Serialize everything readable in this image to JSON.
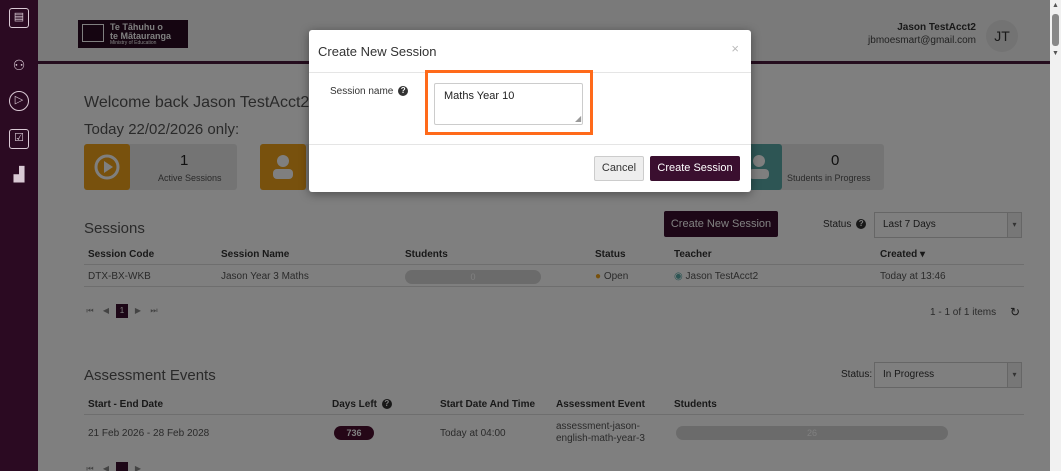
{
  "sidebar": {
    "icons": [
      "book-icon",
      "people-icon",
      "play-circle-icon",
      "checklist-icon",
      "bar-chart-icon"
    ]
  },
  "header": {
    "logo_line1": "Te Tāhuhu o",
    "logo_line2": "te Mātauranga",
    "logo_line3": "Ministry of Education",
    "user_name": "Jason TestAcct2",
    "user_email": "jbmoesmart@gmail.com",
    "avatar_initials": "JT"
  },
  "dashboard": {
    "welcome": "Welcome back Jason TestAcct2",
    "today": "Today 22/02/2026 only:",
    "cards": [
      {
        "number": "1",
        "label": "Active Sessions",
        "color": "#f0a21a"
      },
      {
        "number": "",
        "label": "",
        "color": "#f0a21a"
      },
      {
        "number": "0",
        "label": "Students in Progress",
        "color": "#5aaaa8"
      }
    ]
  },
  "sessions": {
    "title": "Sessions",
    "create_button": "Create New Session",
    "status_label": "Status",
    "filter_value": "Last 7 Days",
    "columns": [
      "Session Code",
      "Session Name",
      "Students",
      "Status",
      "Teacher",
      "Created ▾"
    ],
    "rows": [
      {
        "code": "DTX-BX-WKB",
        "name": "Jason Year 3 Maths",
        "students": "0",
        "status": "Open",
        "teacher": "Jason TestAcct2",
        "created": "Today at 13:46"
      }
    ],
    "pager_current": "1",
    "items_text": "1 - 1 of 1 items"
  },
  "assessments": {
    "title": "Assessment Events",
    "status_label": "Status:",
    "filter_value": "In Progress",
    "columns": [
      "Start - End Date",
      "Days Left",
      "Start Date And Time",
      "Assessment Event",
      "Students"
    ],
    "rows": [
      {
        "dates": "21 Feb 2026 - 28 Feb 2028",
        "days_left": "736",
        "start": "Today at 04:00",
        "event_line1": "assessment-jason-",
        "event_line2": "english-math-year-3",
        "students": "26"
      }
    ]
  },
  "modal": {
    "title": "Create New Session",
    "close": "×",
    "session_name_label": "Session name",
    "session_name_value": "Maths Year 10",
    "cancel": "Cancel",
    "submit": "Create Session"
  },
  "colors": {
    "sidebar": "#2b0a22",
    "primary": "#3a0f2f",
    "highlight": "#ff6a1a"
  }
}
